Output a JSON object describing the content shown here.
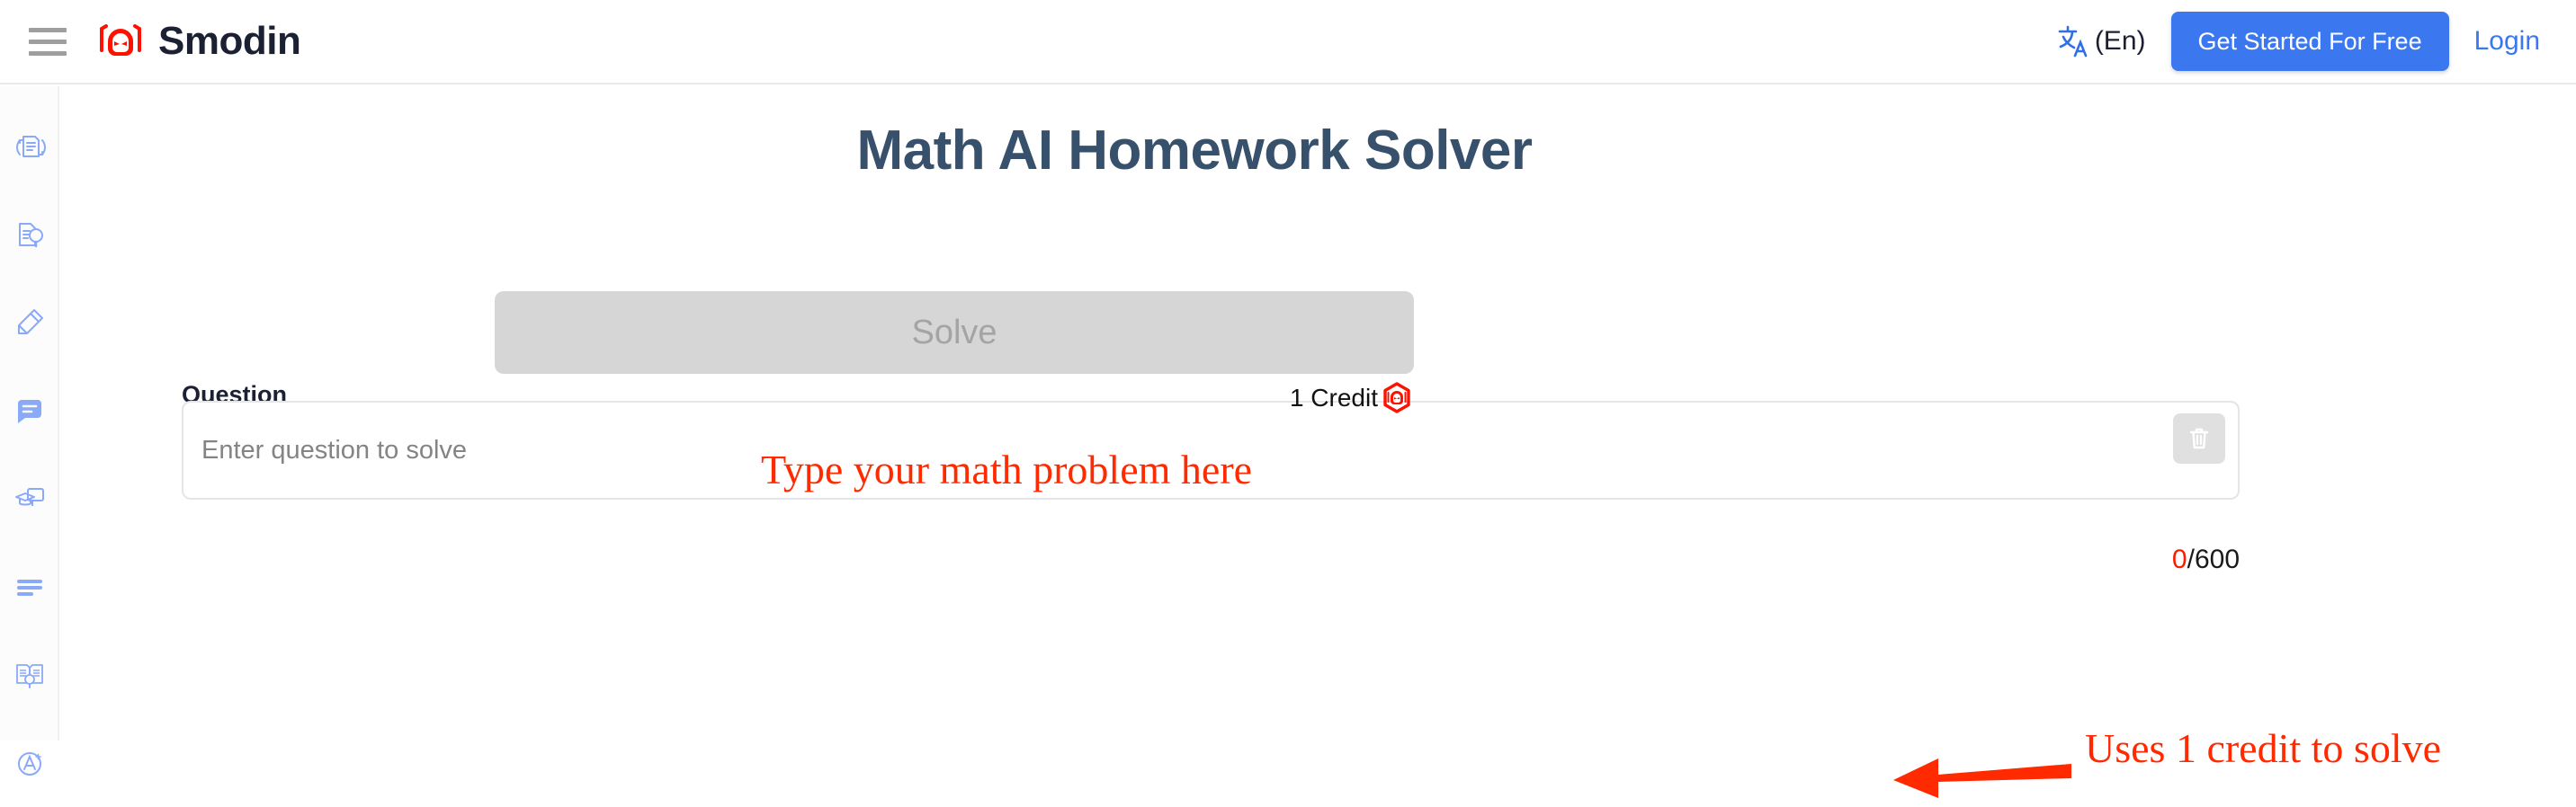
{
  "header": {
    "menu_icon": "hamburger-menu-icon",
    "brand_name": "Smodin",
    "brand_icon": "smodin-robot-logo",
    "language": {
      "icon": "translate-icon",
      "label": "(En)"
    },
    "cta_label": "Get Started For Free",
    "login_label": "Login",
    "accent_blue": "#3b77ef"
  },
  "sidebar": {
    "items": [
      {
        "icon": "rewriter-document-icon",
        "name": "rewriter"
      },
      {
        "icon": "plagiarism-checker-icon",
        "name": "plagiarism-checker"
      },
      {
        "icon": "writer-pencil-icon",
        "name": "writer"
      },
      {
        "icon": "chat-bubble-icon",
        "name": "chat"
      },
      {
        "icon": "graduation-cap-screen-icon",
        "name": "homework-solver"
      },
      {
        "icon": "summarizer-lines-icon",
        "name": "summarizer"
      },
      {
        "icon": "research-book-icon",
        "name": "research"
      },
      {
        "icon": "a-plus-grader-icon",
        "name": "grader"
      }
    ]
  },
  "main": {
    "title": "Math AI Homework Solver",
    "question_label": "Question",
    "question_value": "",
    "question_placeholder": "Enter question to solve",
    "clear_icon": "trash-icon",
    "char_used": "0",
    "char_limit": "/600",
    "solve_label": "Solve",
    "credit_text": "1 Credit",
    "credit_icon": "smodin-credit-badge-icon"
  },
  "annotations": {
    "color": "#ff2a00",
    "input_note": "Type your math problem here",
    "credit_note": "Uses 1 credit to solve",
    "arrow_icon": "left-arrow-annotation"
  }
}
